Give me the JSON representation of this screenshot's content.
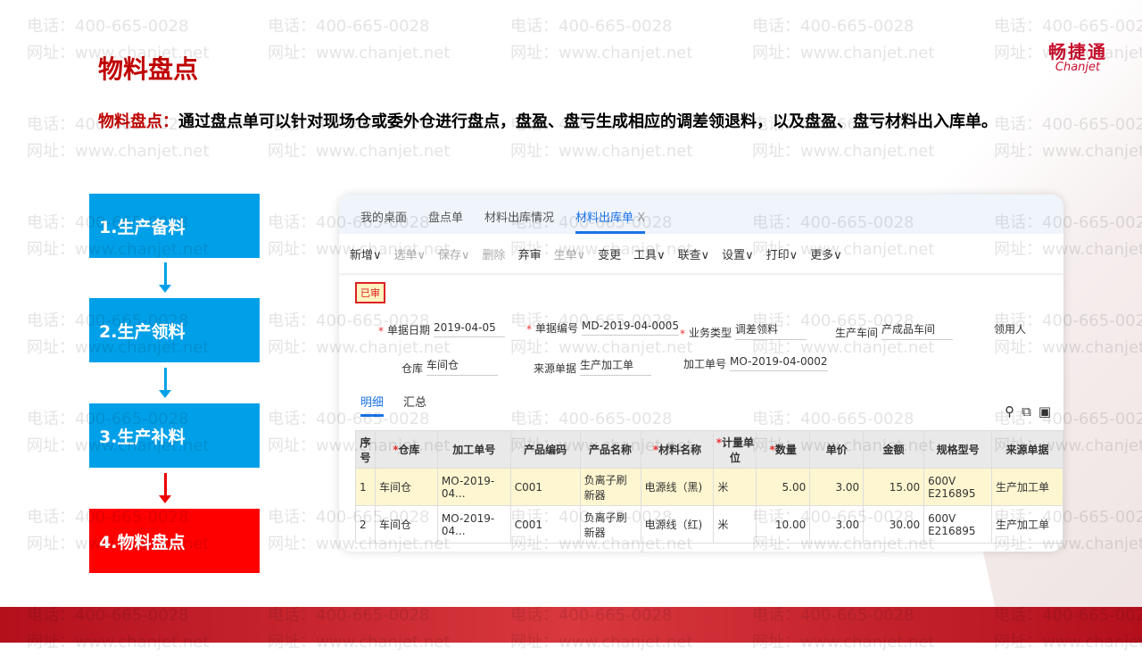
{
  "watermark": {
    "phone": "电话：400-665-0028",
    "site": "网址：www.chanjet.net"
  },
  "logo": {
    "cn": "畅捷通",
    "en": "Chanjet"
  },
  "title": "物料盘点",
  "description": {
    "lead": "物料盘点：",
    "part1": "通过",
    "strong": "盘点单",
    "part2": "可以针对现场仓或委外仓进行盘点，盘盈、盘亏生成相应的调差领退料，以及盘盈、盘亏材料出入库单。"
  },
  "steps": [
    {
      "label": "1.生产备料"
    },
    {
      "label": "2.生产领料"
    },
    {
      "label": "3.生产补料"
    },
    {
      "label": "4.物料盘点"
    }
  ],
  "colors": {
    "blue": "#00a0e9",
    "red": "#ff0000",
    "title": "#c00000"
  },
  "app": {
    "tabs": [
      "我的桌面",
      "盘点单",
      "材料出库情况",
      "材料出库单"
    ],
    "tab_close": "X",
    "toolbar": [
      "新增∨",
      "选单∨",
      "保存∨",
      "删除",
      "弃审",
      "生单∨",
      "变更",
      "工具∨",
      "联查∨",
      "设置∨",
      "打印∨",
      "更多∨"
    ],
    "status": "已审",
    "fields": {
      "date_label": "单据日期",
      "date": "2019-04-05",
      "no_label": "单据编号",
      "no": "MD-2019-04-0005",
      "type_label": "业务类型",
      "type": "调差领料",
      "workshop_label": "生产车间",
      "workshop": "产成品车间",
      "user_label": "领用人",
      "wh_label": "仓库",
      "wh": "车间仓",
      "src_label": "来源单据",
      "src": "生产加工单",
      "proc_label": "加工单号",
      "proc": "MO-2019-04-0002"
    },
    "subtabs": [
      "明细",
      "汇总"
    ],
    "columns": [
      "序号",
      "仓库",
      "加工单号",
      "产品编码",
      "产品名称",
      "材料名称",
      "计量单位",
      "数量",
      "单价",
      "金额",
      "规格型号",
      "来源单据"
    ],
    "rows": [
      [
        "1",
        "车间仓",
        "MO-2019-04...",
        "C001",
        "负离子刷新器",
        "电源线（黑)",
        "米",
        "5.00",
        "3.00",
        "15.00",
        "600V E216895",
        "生产加工单"
      ],
      [
        "2",
        "车间仓",
        "MO-2019-04...",
        "C001",
        "负离子刷新器",
        "电源线（红)",
        "米",
        "10.00",
        "3.00",
        "30.00",
        "600V E216895",
        "生产加工单"
      ]
    ]
  }
}
